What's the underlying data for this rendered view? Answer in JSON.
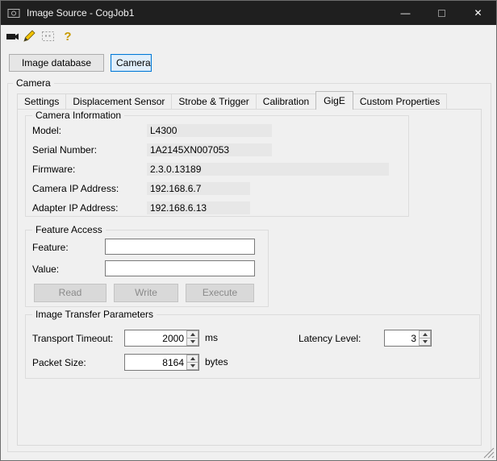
{
  "window": {
    "title": "Image Source - CogJob1",
    "minimize_glyph": "—",
    "close_glyph": "✕"
  },
  "toolbar": {
    "help_glyph": "?"
  },
  "source_selector": {
    "image_database_label": "Image database",
    "camera_label": "Camera"
  },
  "camera_group_title": "Camera",
  "tabs": [
    {
      "label": "Settings",
      "active": false
    },
    {
      "label": "Displacement Sensor",
      "active": false
    },
    {
      "label": "Strobe & Trigger",
      "active": false
    },
    {
      "label": "Calibration",
      "active": false
    },
    {
      "label": "GigE",
      "active": true
    },
    {
      "label": "Custom Properties",
      "active": false
    }
  ],
  "camera_information": {
    "title": "Camera Information",
    "fields": [
      {
        "label": "Model:",
        "value": "L4300"
      },
      {
        "label": "Serial Number:",
        "value": "1A2145XN007053"
      },
      {
        "label": "Firmware:",
        "value": "2.3.0.13189"
      },
      {
        "label": "Camera IP Address:",
        "value": "192.168.6.7"
      },
      {
        "label": "Adapter IP Address:",
        "value": "192.168.6.13"
      }
    ]
  },
  "feature_access": {
    "title": "Feature Access",
    "feature_label": "Feature:",
    "feature_value": "",
    "value_label": "Value:",
    "value_value": "",
    "read_label": "Read",
    "write_label": "Write",
    "execute_label": "Execute"
  },
  "image_transfer_parameters": {
    "title": "Image Transfer Parameters",
    "transport_timeout_label": "Transport Timeout:",
    "transport_timeout_value": "2000",
    "transport_timeout_unit": "ms",
    "latency_level_label": "Latency Level:",
    "latency_level_value": "3",
    "packet_size_label": "Packet Size:",
    "packet_size_value": "8164",
    "packet_size_unit": "bytes"
  },
  "colors": {
    "titlebar_bg": "#1f1f1f",
    "selected_button_border": "#0078d7",
    "selected_button_bg": "#e1effb",
    "readonly_field_bg": "#e7e7e7"
  }
}
